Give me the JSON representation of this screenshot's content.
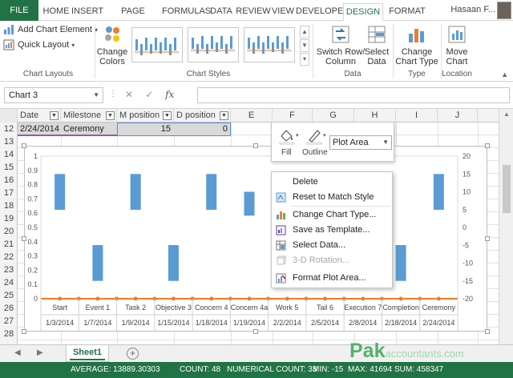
{
  "ribbon": {
    "tabs": [
      "FILE",
      "HOME",
      "INSERT",
      "PAGE LAYOUT",
      "FORMULAS",
      "DATA",
      "REVIEW",
      "VIEW",
      "DEVELOPER",
      "DESIGN",
      "FORMAT"
    ],
    "active_tab": "DESIGN",
    "user": "Hasaan F...",
    "add_chart_element": "Add Chart Element",
    "quick_layout": "Quick Layout",
    "change_colors_line1": "Change",
    "change_colors_line2": "Colors",
    "switch_row_col_line1": "Switch Row/",
    "switch_row_col_line2": "Column",
    "select_data_line1": "Select",
    "select_data_line2": "Data",
    "change_chart_type_line1": "Change",
    "change_chart_type_line2": "Chart Type",
    "move_chart_line1": "Move",
    "move_chart_line2": "Chart",
    "groups": {
      "chart_layouts": "Chart Layouts",
      "chart_styles": "Chart Styles",
      "data": "Data",
      "type": "Type",
      "location": "Location"
    }
  },
  "formula_bar": {
    "name_box": "Chart 3",
    "fx": "fx"
  },
  "grid": {
    "columns": [
      {
        "label": "Date",
        "filter": true
      },
      {
        "label": "Milestone",
        "filter": true
      },
      {
        "label": "M position",
        "filter": true
      },
      {
        "label": "D position",
        "filter": true
      },
      {
        "label": "E",
        "filter": false
      },
      {
        "label": "F",
        "filter": false
      },
      {
        "label": "G",
        "filter": false
      },
      {
        "label": "H",
        "filter": false
      },
      {
        "label": "I",
        "filter": false
      },
      {
        "label": "J",
        "filter": false
      }
    ],
    "rows": [
      "12",
      "13",
      "14",
      "15",
      "16",
      "17",
      "18",
      "19",
      "20",
      "21",
      "22",
      "23",
      "24",
      "25",
      "26",
      "27",
      "28"
    ],
    "row12": {
      "date": "2/24/2014",
      "milestone": "Ceremony",
      "m_position": "15",
      "d_position": "0"
    }
  },
  "chart_data": {
    "type": "bar",
    "categories": [
      "Start",
      "Event 1",
      "Task 2",
      "Objective 3",
      "Concern 4",
      "Concern 4a",
      "Work 5",
      "Tail 6",
      "Execution 7",
      "Completion",
      "Ceremony"
    ],
    "dates": [
      "1/3/2014",
      "1/7/2014",
      "1/9/2014",
      "1/15/2014",
      "1/18/2014",
      "1/19/2014",
      "2/2/2014",
      "2/5/2014",
      "2/8/2014",
      "2/18/2014",
      "2/24/2014"
    ],
    "series": [
      {
        "values": [
          15,
          -15,
          15,
          -15,
          15,
          10,
          -15,
          15,
          15,
          -15,
          15
        ]
      }
    ],
    "left_axis": {
      "ticks": [
        "0",
        "0.1",
        "0.2",
        "0.3",
        "0.4",
        "0.5",
        "0.6",
        "0.7",
        "0.8",
        "0.9",
        "1"
      ]
    },
    "right_axis": {
      "ticks": [
        "-20",
        "-15",
        "-10",
        "-5",
        "0",
        "5",
        "10",
        "15",
        "20"
      ],
      "ylim": [
        -20,
        20
      ]
    },
    "bar_color": "#5b9bd5",
    "line_color": "#ed7d31"
  },
  "format_popup": {
    "fill": "Fill",
    "outline": "Outline",
    "element": "Plot Area"
  },
  "context_menu": {
    "items": [
      {
        "label": "Delete",
        "disabled": false
      },
      {
        "label": "Reset to Match Style",
        "disabled": false
      },
      {
        "label": "Change Chart Type...",
        "disabled": false
      },
      {
        "label": "Save as Template...",
        "disabled": false
      },
      {
        "label": "Select Data...",
        "disabled": false
      },
      {
        "label": "3-D Rotation...",
        "disabled": true
      },
      {
        "label": "Format Plot Area...",
        "disabled": false
      }
    ]
  },
  "sheet": {
    "name": "Sheet1",
    "add": "+"
  },
  "status": {
    "average": "AVERAGE: 13889.30303",
    "count": "COUNT: 48",
    "numerical_count": "NUMERICAL COUNT: 33",
    "min": "MIN: -15",
    "max": "MAX: 41694",
    "sum": "SUM: 458347"
  },
  "watermark": {
    "brand": "Pak",
    "domain": "accountants.com"
  }
}
